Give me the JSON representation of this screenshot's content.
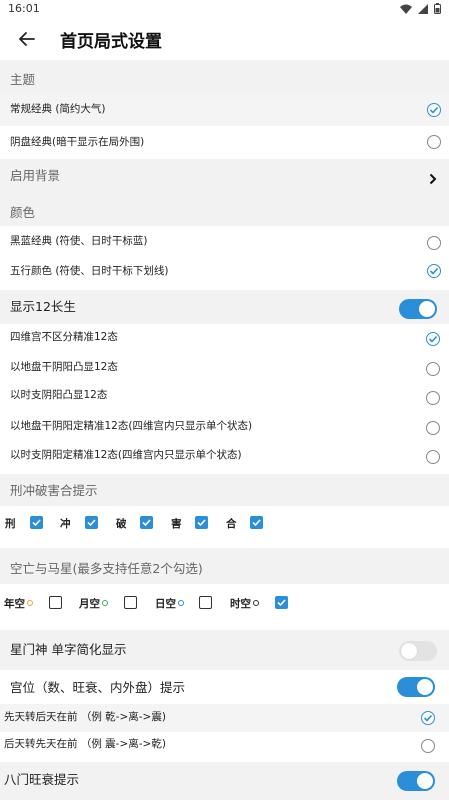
{
  "status": {
    "time": "16:01"
  },
  "header": {
    "title": "首页局式设置"
  },
  "theme": {
    "section": "主题",
    "options": [
      {
        "label": "常规经典 (简约大气)",
        "selected": true
      },
      {
        "label": "阴盘经典(暗干显示在局外围)",
        "selected": false
      }
    ]
  },
  "background": {
    "label": "启用背景"
  },
  "color": {
    "section": "颜色",
    "options": [
      {
        "label": "黑蓝经典 (符使、日时干标蓝)",
        "selected": false
      },
      {
        "label": "五行颜色 (符使、日时干标下划线)",
        "selected": true
      }
    ]
  },
  "twelve": {
    "label": "显示12长生",
    "on": true,
    "options": [
      {
        "label": "四维宫不区分精准12态",
        "selected": true
      },
      {
        "label": "以地盘干阴阳凸显12态",
        "selected": false
      },
      {
        "label": "以时支阴阳凸显12态",
        "selected": false
      },
      {
        "label": "以地盘干阴阳定精准12态(四维宫内只显示单个状态)",
        "selected": false
      },
      {
        "label": "以时支阴阳定精准12态(四维宫内只显示单个状态)",
        "selected": false
      }
    ]
  },
  "xingchong": {
    "section": "刑冲破害合提示",
    "items": [
      {
        "label": "刑",
        "checked": true
      },
      {
        "label": "冲",
        "checked": true
      },
      {
        "label": "破",
        "checked": true
      },
      {
        "label": "害",
        "checked": true
      },
      {
        "label": "合",
        "checked": true
      }
    ]
  },
  "kongwang": {
    "section": "空亡与马星(最多支持任意2个勾选)",
    "items": [
      {
        "label": "年空",
        "dot_color": "#e8a33a",
        "checked": false
      },
      {
        "label": "月空",
        "dot_color": "#3cae4a",
        "checked": false
      },
      {
        "label": "日空",
        "dot_color": "#2a8fd8",
        "checked": false
      },
      {
        "label": "时空",
        "dot_color": "#333333",
        "checked": true
      }
    ]
  },
  "xingmen": {
    "label": "星门神 单字简化显示",
    "on": false
  },
  "gongwei": {
    "label": "宫位（数、旺衰、内外盘）提示",
    "on": true,
    "options": [
      {
        "label": "先天转后天在前 （例 乾->离->震)",
        "selected": true
      },
      {
        "label": "后天转先天在前 （例 震->离->乾)",
        "selected": false
      }
    ]
  },
  "bamen": {
    "label": "八门旺衰提示",
    "on": true
  },
  "colors": {
    "accent": "#2a8fd8",
    "section_bg": "#f2f2f2"
  }
}
